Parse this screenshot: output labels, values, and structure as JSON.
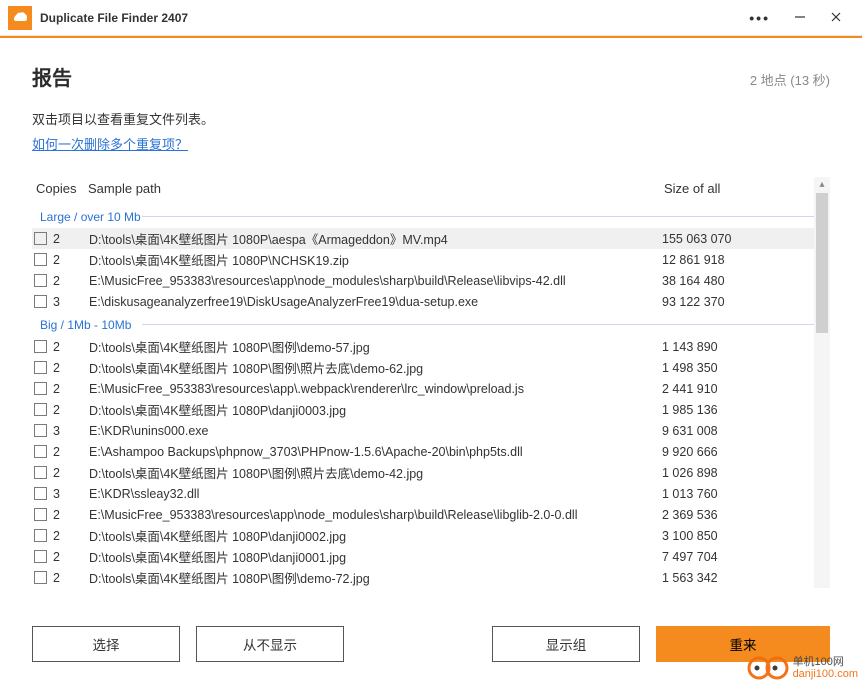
{
  "titlebar": {
    "app_title": "Duplicate File Finder 2407"
  },
  "report": {
    "title": "报告",
    "status": "2 地点 (13 秒)",
    "hint": "双击项目以查看重复文件列表。",
    "help_link": "如何一次删除多个重复项？"
  },
  "columns": {
    "copies": "Copies",
    "path": "Sample path",
    "size": "Size of all"
  },
  "groups": [
    {
      "label": "Large / over 10 Mb",
      "rows": [
        {
          "copies": "2",
          "path": "D:\\tools\\桌面\\4K壁纸图片 1080P\\aespa《Armageddon》MV.mp4",
          "size": "155 063 070",
          "selected": true
        },
        {
          "copies": "2",
          "path": "D:\\tools\\桌面\\4K壁纸图片 1080P\\NCHSK19.zip",
          "size": "12 861 918"
        },
        {
          "copies": "2",
          "path": "E:\\MusicFree_953383\\resources\\app\\node_modules\\sharp\\build\\Release\\libvips-42.dll",
          "size": "38 164 480"
        },
        {
          "copies": "3",
          "path": "E:\\diskusageanalyzerfree19\\DiskUsageAnalyzerFree19\\dua-setup.exe",
          "size": "93 122 370"
        }
      ]
    },
    {
      "label": "Big / 1Mb - 10Mb",
      "rows": [
        {
          "copies": "2",
          "path": "D:\\tools\\桌面\\4K壁纸图片 1080P\\图例\\demo-57.jpg",
          "size": "1 143 890"
        },
        {
          "copies": "2",
          "path": "D:\\tools\\桌面\\4K壁纸图片 1080P\\图例\\照片去底\\demo-62.jpg",
          "size": "1 498 350"
        },
        {
          "copies": "2",
          "path": "E:\\MusicFree_953383\\resources\\app\\.webpack\\renderer\\lrc_window\\preload.js",
          "size": "2 441 910"
        },
        {
          "copies": "2",
          "path": "D:\\tools\\桌面\\4K壁纸图片 1080P\\danji0003.jpg",
          "size": "1 985 136"
        },
        {
          "copies": "3",
          "path": "E:\\KDR\\unins000.exe",
          "size": "9 631 008"
        },
        {
          "copies": "2",
          "path": "E:\\Ashampoo Backups\\phpnow_3703\\PHPnow-1.5.6\\Apache-20\\bin\\php5ts.dll",
          "size": "9 920 666"
        },
        {
          "copies": "2",
          "path": "D:\\tools\\桌面\\4K壁纸图片 1080P\\图例\\照片去底\\demo-42.jpg",
          "size": "1 026 898"
        },
        {
          "copies": "3",
          "path": "E:\\KDR\\ssleay32.dll",
          "size": "1 013 760"
        },
        {
          "copies": "2",
          "path": "E:\\MusicFree_953383\\resources\\app\\node_modules\\sharp\\build\\Release\\libglib-2.0-0.dll",
          "size": "2 369 536"
        },
        {
          "copies": "2",
          "path": "D:\\tools\\桌面\\4K壁纸图片 1080P\\danji0002.jpg",
          "size": "3 100 850"
        },
        {
          "copies": "2",
          "path": "D:\\tools\\桌面\\4K壁纸图片 1080P\\danji0001.jpg",
          "size": "7 497 704"
        },
        {
          "copies": "2",
          "path": "D:\\tools\\桌面\\4K壁纸图片 1080P\\图例\\demo-72.jpg",
          "size": "1 563 342"
        }
      ]
    }
  ],
  "footer": {
    "select": "选择",
    "never_show": "从不显示",
    "show_group": "显示组",
    "restart": "重来"
  },
  "watermark": {
    "top": "单机100网",
    "bottom": "danji100.com"
  }
}
